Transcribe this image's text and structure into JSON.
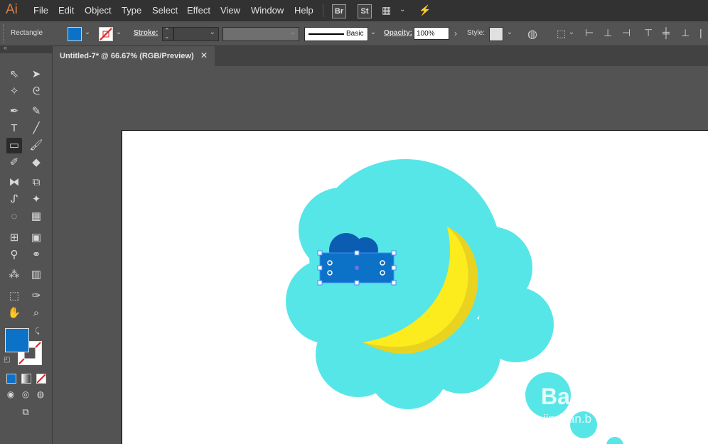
{
  "app": {
    "logo": "Ai"
  },
  "menu": [
    "File",
    "Edit",
    "Object",
    "Type",
    "Select",
    "Effect",
    "View",
    "Window",
    "Help"
  ],
  "bridge": [
    "Br",
    "St"
  ],
  "control": {
    "tool_name": "Rectangle",
    "stroke_label": "Stroke:",
    "brush_label": "Basic",
    "opacity_label": "Opacity:",
    "opacity_value": "100%",
    "style_label": "Style:",
    "fill_color": "#0b72c8"
  },
  "document": {
    "tab_title": "Untitled-7* @ 66.67% (RGB/Preview)",
    "close_glyph": "✕"
  },
  "colors": {
    "cloud": "#57e6e8",
    "moon": "#fcec1e",
    "moon_shade": "#e9d320",
    "blue": "#0b72c8",
    "dark_blue": "#0a5db0"
  },
  "watermark": {
    "line1": "Bai",
    "line2": "jingyan.b"
  }
}
